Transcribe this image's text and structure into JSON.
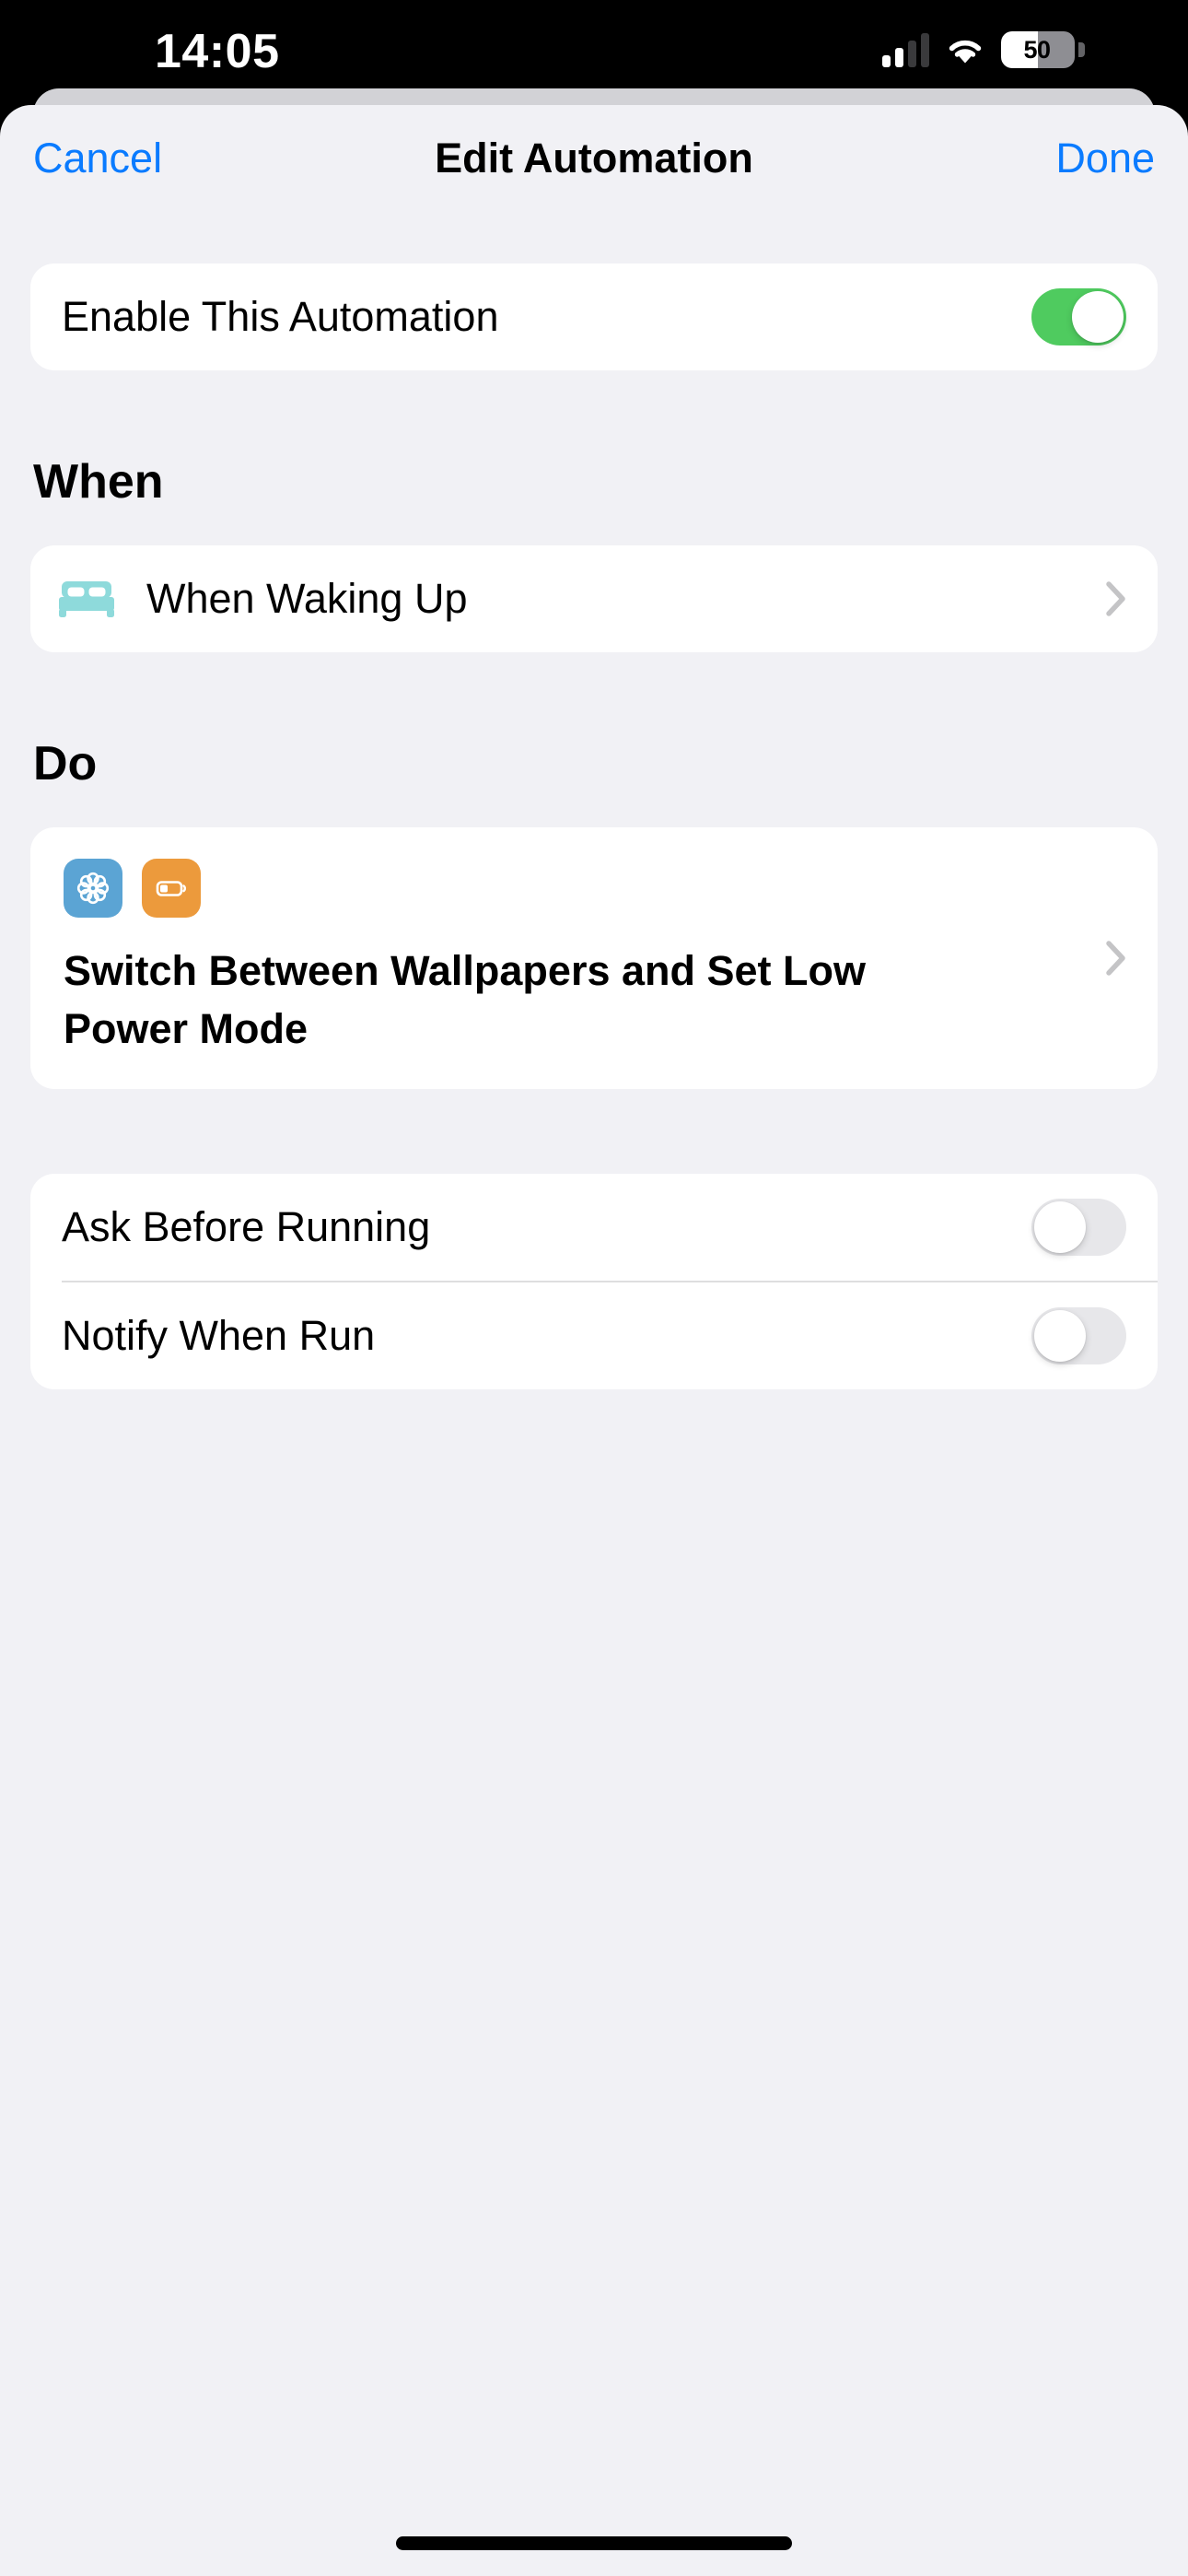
{
  "status_bar": {
    "time": "14:05",
    "battery_percent": "50",
    "battery_level": 50,
    "cellular_bars_filled": 2,
    "cellular_bars_total": 4,
    "wifi_icon": "wifi-icon",
    "battery_icon": "battery-icon"
  },
  "nav": {
    "cancel_label": "Cancel",
    "title": "Edit Automation",
    "done_label": "Done",
    "accent_color": "#0a7bff"
  },
  "enable_section": {
    "label": "Enable This Automation",
    "toggle_state": "on",
    "toggle_on_color": "#4fcb5f"
  },
  "when_section": {
    "header": "When",
    "trigger": {
      "icon": "bed-double-icon",
      "icon_color": "#8edadb",
      "label": "When Waking Up",
      "chevron": "chevron-right-icon"
    }
  },
  "do_section": {
    "header": "Do",
    "action": {
      "title": "Switch Between Wallpapers and Set Low Power Mode",
      "app_icons": [
        {
          "name": "wallpaper-icon",
          "color": "#5ba4d4"
        },
        {
          "name": "low-power-mode-battery-icon",
          "color": "#ec9a3c"
        }
      ],
      "chevron": "chevron-right-icon"
    }
  },
  "options_section": {
    "rows": [
      {
        "label": "Ask Before Running",
        "toggle_state": "off"
      },
      {
        "label": "Notify When Run",
        "toggle_state": "off"
      }
    ]
  }
}
